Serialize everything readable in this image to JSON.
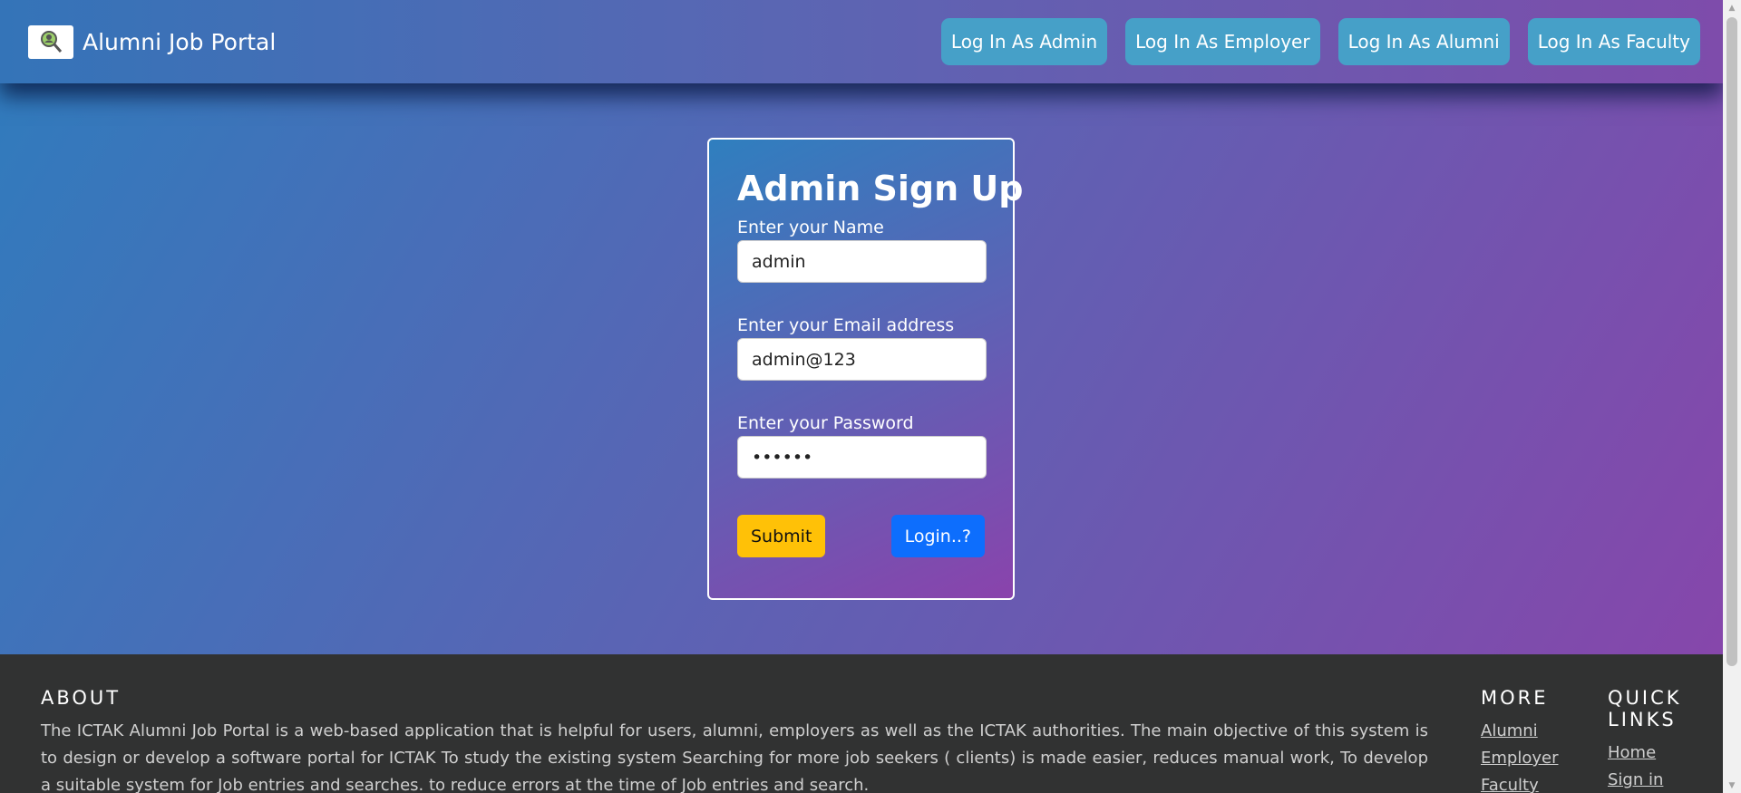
{
  "navbar": {
    "brand_title": "Alumni Job Portal",
    "logo_icon": "magnifier-logo-icon",
    "buttons": [
      "Log In As Admin",
      "Log In As Employer",
      "Log In As Alumni",
      "Log In As Faculty"
    ]
  },
  "form": {
    "title": "Admin Sign Up",
    "name_label": "Enter your Name",
    "name_value": "admin",
    "email_label": "Enter your Email address",
    "email_value": "admin@123",
    "password_label": "Enter your Password",
    "password_value": "••••••",
    "submit_label": "Submit",
    "login_label": "Login..?"
  },
  "footer": {
    "about_heading": "ABOUT",
    "about_text": "The ICTAK Alumni Job Portal is a web-based application that is helpful for users, alumni, employers as well as the ICTAK authorities. The main objective of this system is to design or develop a software portal for ICTAK To study the existing system Searching for more job seekers ( clients) is made easier, reduces manual work, To develop a suitable system for Job entries and searches. to reduce errors at the time of Job entries and search.",
    "more_heading": "MORE",
    "more_links": [
      "Alumni",
      "Employer",
      "Faculty"
    ],
    "quick_heading": "QUICK LINKS",
    "quick_links": [
      "Home",
      "Sign in"
    ]
  },
  "colors": {
    "nav_button": "#46a0c8",
    "submit_button": "#ffc107",
    "login_button": "#0d6efd",
    "footer_bg": "#313232"
  }
}
